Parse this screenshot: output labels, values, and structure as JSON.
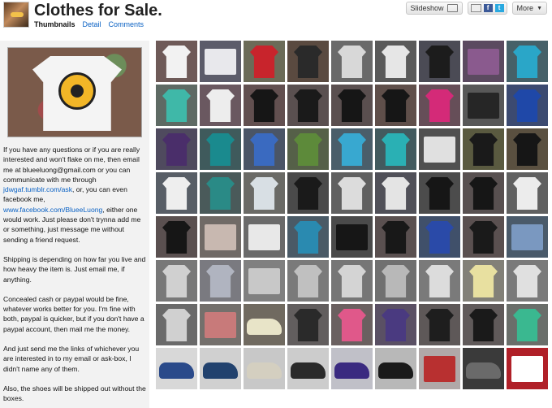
{
  "header": {
    "title": "Clothes for Sale.",
    "tabs": [
      {
        "label": "Thumbnails",
        "active": true
      },
      {
        "label": "Detail",
        "active": false
      },
      {
        "label": "Comments",
        "active": false
      }
    ],
    "slideshow_label": "Slideshow",
    "more_label": "More",
    "share_icons": [
      "mail-icon",
      "facebook-icon",
      "twitter-icon"
    ]
  },
  "description": {
    "paragraphs": [
      [
        {
          "text": "If you have any questions or if you are really interested and won't flake on me, then email me at blueeluong@gmail.com or you can communicate with me through ",
          "link": false
        },
        {
          "text": "jdwgaf.tumblr.com/ask",
          "link": true
        },
        {
          "text": ", or, you can even facebook me, ",
          "link": false
        },
        {
          "text": "www.facebook.com/BlueeLuong",
          "link": true
        },
        {
          "text": ", either one would work. Just please don't trynna add me or something, just message me without sending a friend request.",
          "link": false
        }
      ],
      [
        {
          "text": "Shipping is depending on how far you live and how heavy the item is. Just email me, if anything.",
          "link": false
        }
      ],
      [
        {
          "text": "Concealed cash or paypal would be fine, whatever works better for you. I'm fine with both, paypal is quicker, but if you don't have a paypal account, then mail me the money.",
          "link": false
        }
      ],
      [
        {
          "text": "And just send me the links of whichever you are interested in to my email or ask-box, I didn't name any of them.",
          "link": false
        }
      ],
      [
        {
          "text": "Also, the shoes will be shipped out without the boxes.",
          "link": false
        }
      ]
    ]
  },
  "thumbnails": [
    {
      "kind": "tee",
      "bg": "#6e5a58",
      "fg": "#f2f2f2"
    },
    {
      "kind": "flat",
      "bg": "#5c5c6a",
      "fg": "#e8e8ec"
    },
    {
      "kind": "tee",
      "bg": "#6b6b58",
      "fg": "#c8242c"
    },
    {
      "kind": "tee",
      "bg": "#5a4a40",
      "fg": "#2a2a2a"
    },
    {
      "kind": "tee",
      "bg": "#6a6a6a",
      "fg": "#d8d8d8"
    },
    {
      "kind": "tee",
      "bg": "#5a5a5a",
      "fg": "#e6e6e6"
    },
    {
      "kind": "tee",
      "bg": "#4b4b55",
      "fg": "#1c1c1c"
    },
    {
      "kind": "flat",
      "bg": "#5b4a60",
      "fg": "#8a5a8e"
    },
    {
      "kind": "tee",
      "bg": "#466068",
      "fg": "#2aa6c8"
    },
    {
      "kind": "tee",
      "bg": "#5e6a64",
      "fg": "#3fb8a8"
    },
    {
      "kind": "tee",
      "bg": "#6a5860",
      "fg": "#ededed"
    },
    {
      "kind": "tee",
      "bg": "#625050",
      "fg": "#161616"
    },
    {
      "kind": "tee",
      "bg": "#5a5050",
      "fg": "#1a1a1a"
    },
    {
      "kind": "tee",
      "bg": "#5a4f4f",
      "fg": "#161616"
    },
    {
      "kind": "tee",
      "bg": "#5f4f4a",
      "fg": "#161616"
    },
    {
      "kind": "tee",
      "bg": "#664e58",
      "fg": "#d42a78"
    },
    {
      "kind": "flat",
      "bg": "#585858",
      "fg": "#262626"
    },
    {
      "kind": "tee",
      "bg": "#3c4a70",
      "fg": "#1f48a8"
    },
    {
      "kind": "tee",
      "bg": "#4f4a5e",
      "fg": "#4a2e6a"
    },
    {
      "kind": "tee",
      "bg": "#3f5a5c",
      "fg": "#1a8a8e"
    },
    {
      "kind": "tee",
      "bg": "#4a5566",
      "fg": "#3a6ac0"
    },
    {
      "kind": "tee",
      "bg": "#556048",
      "fg": "#5d8a3a"
    },
    {
      "kind": "tee",
      "bg": "#4a5e6a",
      "fg": "#38a8d0"
    },
    {
      "kind": "tee",
      "bg": "#425a5e",
      "fg": "#2ab0b4"
    },
    {
      "kind": "flat",
      "bg": "#505050",
      "fg": "#e0e0e0"
    },
    {
      "kind": "tee",
      "bg": "#5a5a40",
      "fg": "#1a1a1a"
    },
    {
      "kind": "tee",
      "bg": "#5a5040",
      "fg": "#161616"
    },
    {
      "kind": "tee",
      "bg": "#585e66",
      "fg": "#eeeeee"
    },
    {
      "kind": "tee",
      "bg": "#4a5a5a",
      "fg": "#2a8a86"
    },
    {
      "kind": "tee",
      "bg": "#6a6a66",
      "fg": "#d8dfe4"
    },
    {
      "kind": "tee",
      "bg": "#4a4a4a",
      "fg": "#1a1a1a"
    },
    {
      "kind": "tee",
      "bg": "#606060",
      "fg": "#dcdcdc"
    },
    {
      "kind": "tee",
      "bg": "#505058",
      "fg": "#e4e4e4"
    },
    {
      "kind": "tee",
      "bg": "#4c4c4c",
      "fg": "#161616"
    },
    {
      "kind": "tee",
      "bg": "#585050",
      "fg": "#161616"
    },
    {
      "kind": "tee",
      "bg": "#606060",
      "fg": "#ececec"
    },
    {
      "kind": "tee",
      "bg": "#5a5050",
      "fg": "#161616"
    },
    {
      "kind": "flat",
      "bg": "#706a66",
      "fg": "#c8b8b0"
    },
    {
      "kind": "flat",
      "bg": "#6a6a6a",
      "fg": "#e8e8e8"
    },
    {
      "kind": "tee",
      "bg": "#4a5a66",
      "fg": "#2a8ab0"
    },
    {
      "kind": "flat",
      "bg": "#4a4a4a",
      "fg": "#161616"
    },
    {
      "kind": "tee",
      "bg": "#5a5050",
      "fg": "#181818"
    },
    {
      "kind": "tee",
      "bg": "#40506a",
      "fg": "#2a4aa8"
    },
    {
      "kind": "tee",
      "bg": "#5a5050",
      "fg": "#1a1a1a"
    },
    {
      "kind": "flat",
      "bg": "#4a5a6a",
      "fg": "#7a98c0"
    },
    {
      "kind": "tee",
      "bg": "#787878",
      "fg": "#d0d0d0"
    },
    {
      "kind": "tee",
      "bg": "#7a7a80",
      "fg": "#b0b4c0"
    },
    {
      "kind": "flat",
      "bg": "#808080",
      "fg": "#c8c8c8"
    },
    {
      "kind": "tee",
      "bg": "#7a7a7a",
      "fg": "#c0c0c0"
    },
    {
      "kind": "tee",
      "bg": "#767676",
      "fg": "#d4d4d4"
    },
    {
      "kind": "tee",
      "bg": "#707070",
      "fg": "#b8b8b8"
    },
    {
      "kind": "tee",
      "bg": "#7a7a7a",
      "fg": "#dcdcdc"
    },
    {
      "kind": "tee",
      "bg": "#828078",
      "fg": "#e8e0a0"
    },
    {
      "kind": "tee",
      "bg": "#7a7a7a",
      "fg": "#e0e0e0"
    },
    {
      "kind": "tee",
      "bg": "#6a6a6a",
      "fg": "#d0d0d0"
    },
    {
      "kind": "flat",
      "bg": "#74706c",
      "fg": "#c87a7a"
    },
    {
      "kind": "shoe",
      "bg": "#706a60",
      "fg": "#e8e4c8"
    },
    {
      "kind": "tee",
      "bg": "#625e5e",
      "fg": "#2a2a2a"
    },
    {
      "kind": "tee",
      "bg": "#6a6060",
      "fg": "#e0588a"
    },
    {
      "kind": "tee",
      "bg": "#5a5064",
      "fg": "#4a3a80"
    },
    {
      "kind": "tee",
      "bg": "#5e5858",
      "fg": "#1e1e1e"
    },
    {
      "kind": "tee",
      "bg": "#605a5a",
      "fg": "#1a1a1a"
    },
    {
      "kind": "tee",
      "bg": "#6a6e6a",
      "fg": "#3ab890"
    },
    {
      "kind": "shoe",
      "bg": "#d8d8d8",
      "fg": "#2a4a8a"
    },
    {
      "kind": "shoe",
      "bg": "#d0d0d0",
      "fg": "#22426e"
    },
    {
      "kind": "shoe",
      "bg": "#c8c8c8",
      "fg": "#d4cfc0"
    },
    {
      "kind": "shoe",
      "bg": "#cccccc",
      "fg": "#2a2a2a"
    },
    {
      "kind": "shoe",
      "bg": "#c0c0c8",
      "fg": "#3a2a80"
    },
    {
      "kind": "shoe",
      "bg": "#b8b8b8",
      "fg": "#1a1a1a"
    },
    {
      "kind": "flat",
      "bg": "#b0a8a8",
      "fg": "#b83030"
    },
    {
      "kind": "shoe",
      "bg": "#3a3a3a",
      "fg": "#6a6a6a"
    },
    {
      "kind": "flat",
      "bg": "#b02028",
      "fg": "#ffffff"
    }
  ]
}
